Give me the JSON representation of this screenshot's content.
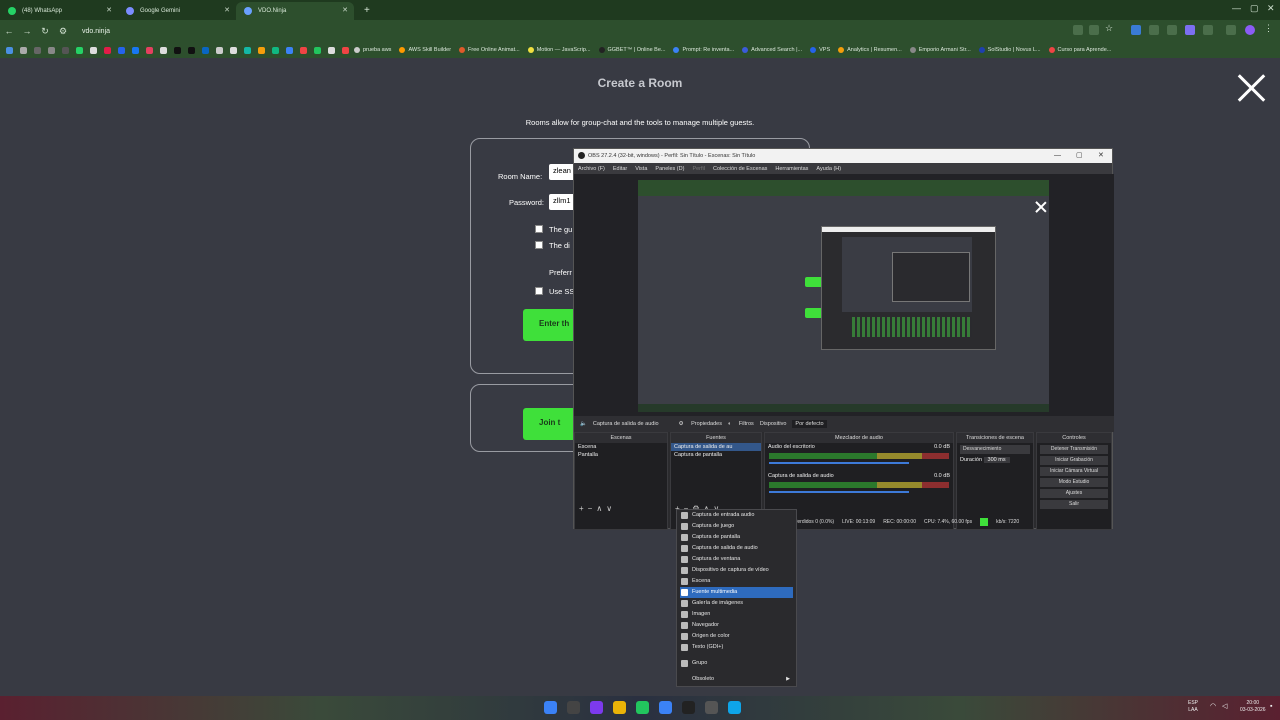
{
  "browser": {
    "tabs": [
      {
        "label": "(48) WhatsApp",
        "color": "#25d366"
      },
      {
        "label": "Google Gemini",
        "color": "#7b8cff"
      },
      {
        "label": "VDO.Ninja",
        "color": "#6aa0ff"
      }
    ],
    "url": "vdo.ninja",
    "bookmarks": [
      {
        "label": "prueba aws",
        "color": "#cccccc"
      },
      {
        "label": "AWS Skill Builder",
        "color": "#ff9900"
      },
      {
        "label": "Free Online Animat...",
        "color": "#e05a2a"
      },
      {
        "label": "Motion — JavaScrip...",
        "color": "#f0e040"
      },
      {
        "label": "GGBET™ | Online Be...",
        "color": "#222222"
      },
      {
        "label": "Prompt: Re inventa...",
        "color": "#3b82f6"
      },
      {
        "label": "Advanced Search |...",
        "color": "#3b5bdb"
      },
      {
        "label": "VPS",
        "color": "#2563eb"
      },
      {
        "label": "Analytics | Resumen...",
        "color": "#f59e0b"
      },
      {
        "label": "Emporio Armani Str...",
        "color": "#888888"
      },
      {
        "label": "SolStudio | Novus L...",
        "color": "#1e40af"
      },
      {
        "label": "Curso para Aprende...",
        "color": "#ef4444"
      }
    ]
  },
  "page": {
    "title": "Create a Room",
    "subtitle": "Rooms allow for group-chat and the tools to manage multiple guests.",
    "room_name_label": "Room Name:",
    "room_name_value": "zlean",
    "password_label": "Password:",
    "password_value": "zllm1",
    "checkbox1": "The gu",
    "checkbox2": "The di",
    "preferred_label": "Preferr",
    "ssl_label": "Use SS",
    "enter_button": "Enter th",
    "join_button": "Join t"
  },
  "obs": {
    "title": "OBS 27.2.4 (32-bit, windows) - Perfil: Sin Título - Escenas: Sin Título",
    "menu": [
      "Archivo (F)",
      "Editar",
      "Vista",
      "Paneles (D)",
      "Perfil",
      "Colección de Escenas",
      "Herramientas",
      "Ayuda (H)"
    ],
    "source_toolbar": {
      "source": "Captura de salida de audio",
      "properties": "Propiedades",
      "filters": "Filtros",
      "device": "Dispositivo",
      "default": "Por defecto"
    },
    "docks": {
      "scenes_title": "Escenas",
      "scenes": [
        "Escena",
        "Pantalla"
      ],
      "sources_title": "Fuentes",
      "sources": [
        "Captura de salida de au",
        "Captura de pantalla"
      ],
      "mixer_title": "Mezclador de audio",
      "mixer": [
        {
          "name": "Audio del escritorio",
          "db": "0.0 dB"
        },
        {
          "name": "Captura de salida de audio",
          "db": "0.0 dB"
        }
      ],
      "transitions_title": "Transiciones de escena",
      "transition": "Desvanecimiento",
      "duration_label": "Duración",
      "duration_value": "300 ms",
      "controls_title": "Controles",
      "controls": [
        "Detener Transmisión",
        "Iniciar Grabación",
        "Iniciar Cámara Virtual",
        "Modo Estudio",
        "Ajustes",
        "Salir"
      ]
    },
    "status": {
      "dropped": "Fotogramas Perdidos 0 (0.0%)",
      "live": "LIVE: 00:13:09",
      "rec": "REC: 00:00:00",
      "cpu": "CPU: 7.4%, 60.00 fps",
      "kbps": "kb/s: 7220"
    }
  },
  "context_menu": [
    {
      "label": "Captura de entrada audio",
      "icon": "microphone-icon"
    },
    {
      "label": "Captura de juego",
      "icon": "gamepad-icon"
    },
    {
      "label": "Captura de pantalla",
      "icon": "monitor-icon"
    },
    {
      "label": "Captura de salida de audio",
      "icon": "speaker-icon"
    },
    {
      "label": "Captura de ventana",
      "icon": "window-icon"
    },
    {
      "label": "Dispositivo de captura de vídeo",
      "icon": "camera-icon"
    },
    {
      "label": "Escena",
      "icon": "list-icon"
    },
    {
      "label": "Fuente multimedia",
      "icon": "play-icon",
      "highlighted": true
    },
    {
      "label": "Galería de imágenes",
      "icon": "gallery-icon"
    },
    {
      "label": "Imagen",
      "icon": "image-icon"
    },
    {
      "label": "Navegador",
      "icon": "globe-icon"
    },
    {
      "label": "Origen de color",
      "icon": "paint-icon"
    },
    {
      "label": "Texto (GDI+)",
      "icon": "text-icon"
    },
    {
      "label": "Grupo",
      "icon": "folder-icon"
    },
    {
      "label": "Obsoleto",
      "icon": "",
      "submenu": true
    }
  ],
  "taskbar": {
    "lang": "ESP",
    "layout": "LAA",
    "time": "20:00",
    "date": "03-03-2026"
  }
}
